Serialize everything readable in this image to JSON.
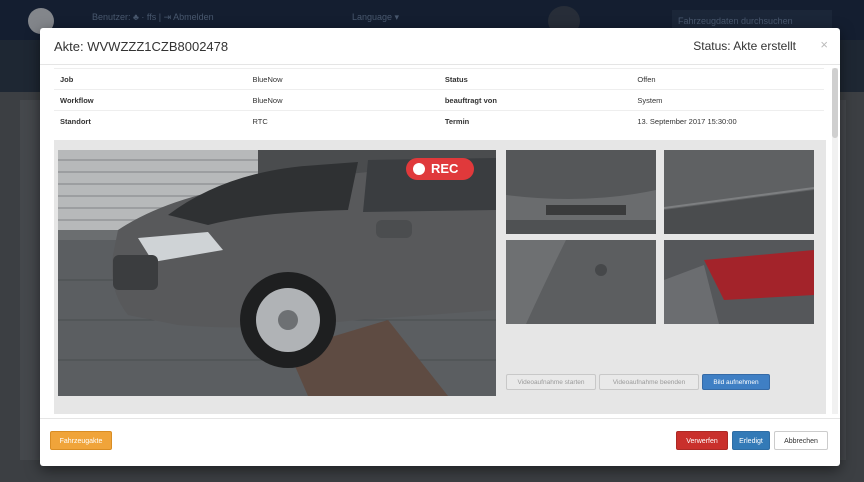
{
  "background": {
    "user_text": "Benutzer: ♣ · ffs | ⇥ Abmelden",
    "language": "Language ▾",
    "search_placeholder": "Fahrzeugdaten durchsuchen"
  },
  "modal": {
    "title": "Akte: WVWZZZ1CZB8002478",
    "status": "Status: Akte erstellt",
    "close": "×"
  },
  "info": {
    "rows": [
      {
        "label1": "Job",
        "value1": "BlueNow",
        "label2": "Status",
        "value2": "Offen"
      },
      {
        "label1": "Workflow",
        "value1": "BlueNow",
        "label2": "beauftragt von",
        "value2": "System"
      },
      {
        "label1": "Standort",
        "value1": "RTC",
        "label2": "Termin",
        "value2": "13. September 2017 15:30:00"
      }
    ]
  },
  "media": {
    "rec_label": "REC",
    "buttons": {
      "start_video": "Videoaufnahme starten",
      "stop_video": "Videoaufnahme beenden",
      "take_picture": "Bild aufnehmen"
    }
  },
  "footer": {
    "vehicle_button": "Fahrzeugakte",
    "reject_button": "Verwerfen",
    "done_button": "Erledigt",
    "cancel_button": "Abbrechen"
  },
  "colors": {
    "rec": "#e0393b",
    "primary": "#337ab7",
    "danger": "#c9302c",
    "warning": "#f0a43a"
  }
}
